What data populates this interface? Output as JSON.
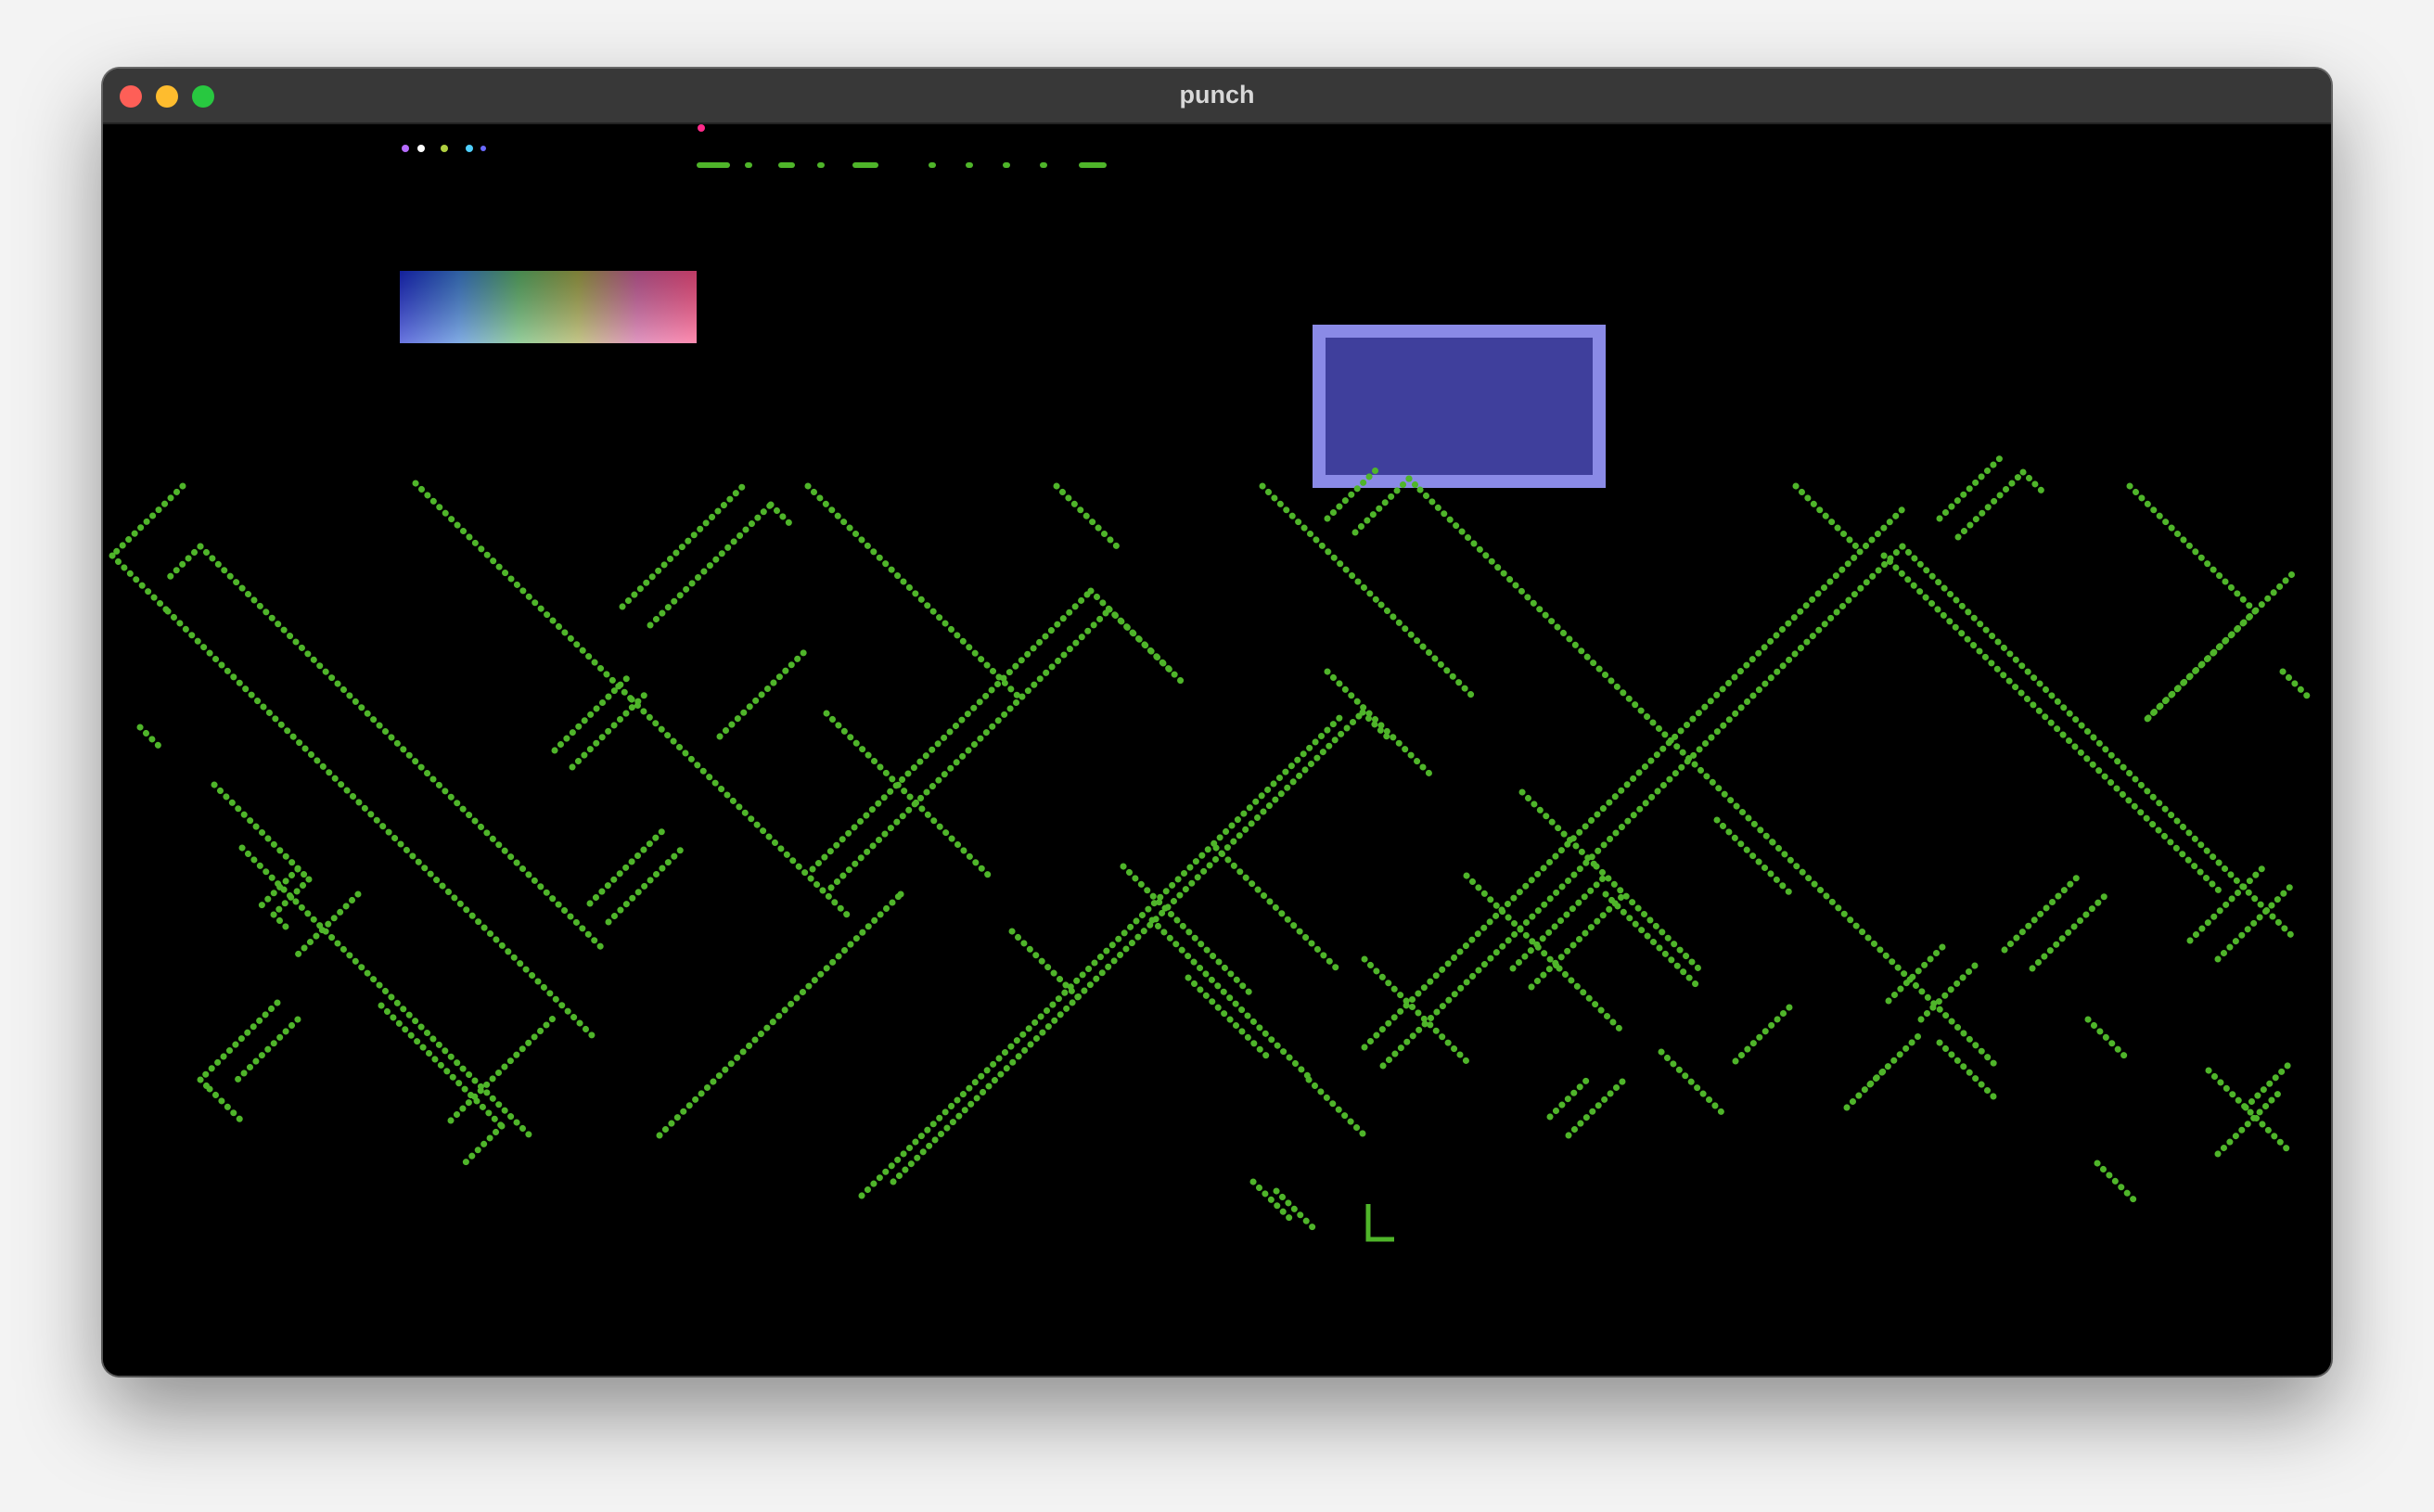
{
  "window": {
    "title": "punch",
    "buttons": [
      "close",
      "minimize",
      "maximize"
    ]
  },
  "colors": {
    "background": "#000000",
    "maze": "#4fb52a",
    "panel_fill": "#3f3f9c",
    "panel_border": "#8a8ae6",
    "titlebar": "#383838"
  },
  "icons": {
    "close": "close-icon",
    "minimize": "minimize-icon",
    "maximize": "maximize-icon"
  }
}
